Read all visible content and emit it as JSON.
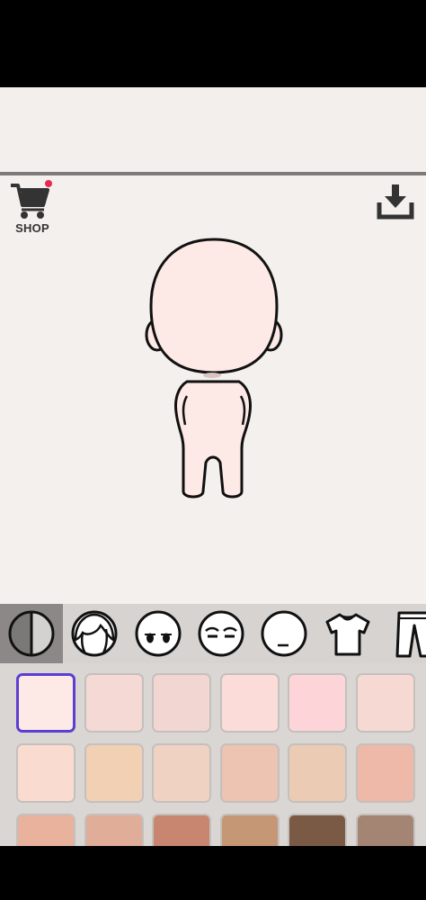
{
  "shop": {
    "label": "SHOP"
  },
  "tabs": [
    {
      "name": "skin-tone-tab",
      "active": true
    },
    {
      "name": "hair-tab",
      "active": false
    },
    {
      "name": "eyes-tab",
      "active": false
    },
    {
      "name": "eyebrows-tab",
      "active": false
    },
    {
      "name": "mouth-tab",
      "active": false
    },
    {
      "name": "shirt-tab",
      "active": false
    },
    {
      "name": "pants-tab",
      "active": false
    }
  ],
  "swatches": [
    "#fde9e5",
    "#f4d9d4",
    "#f2d6d1",
    "#fcdcd8",
    "#fdd5d9",
    "#f6d9d3",
    "#f9dccf",
    "#f2d0b4",
    "#f0d2c3",
    "#edc3b2",
    "#ebcbb4",
    "#eeb9a8",
    "#e8b29c",
    "#dfad98",
    "#c88670",
    "#c69774",
    "#7a5a44",
    "#a48573"
  ],
  "selected_swatch": 0,
  "colors": {
    "accent": "#5a3fd1",
    "notification": "#e8294b",
    "skin": "#fde9e5"
  }
}
